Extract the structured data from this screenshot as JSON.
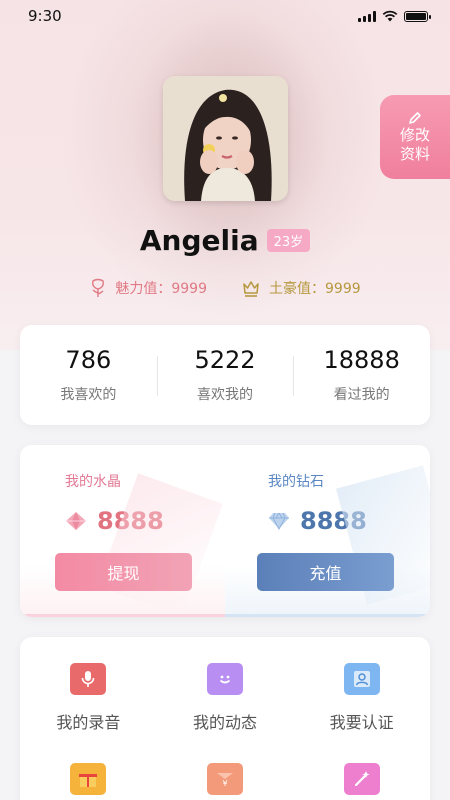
{
  "status_bar": {
    "time": "9:30"
  },
  "profile": {
    "name": "Angelia",
    "age": "23岁",
    "edit_label_line1": "修改",
    "edit_label_line2": "资料",
    "charm": "魅力值：9999",
    "rich": "土豪值：9999"
  },
  "stats": [
    {
      "value": "786",
      "label": "我喜欢的"
    },
    {
      "value": "5222",
      "label": "喜欢我的"
    },
    {
      "value": "18888",
      "label": "看过我的"
    }
  ],
  "wallet": {
    "crystal": {
      "title": "我的水晶",
      "amount": "8888",
      "button": "提现"
    },
    "diamond": {
      "title": "我的钻石",
      "amount": "8888",
      "button": "充值"
    }
  },
  "features": [
    {
      "label": "我的录音",
      "icon": "microphone-icon",
      "color": "#e86a6a"
    },
    {
      "label": "我的动态",
      "icon": "smiley-chat-icon",
      "color": "#b98ef2"
    },
    {
      "label": "我要认证",
      "icon": "person-badge-icon",
      "color": "#7db6f0"
    },
    {
      "label": "",
      "icon": "gift-icon",
      "color": "#f5b33c"
    },
    {
      "label": "",
      "icon": "yen-envelope-icon",
      "color": "#f39a7a"
    },
    {
      "label": "",
      "icon": "magic-wand-icon",
      "color": "#ee7fcf"
    }
  ]
}
